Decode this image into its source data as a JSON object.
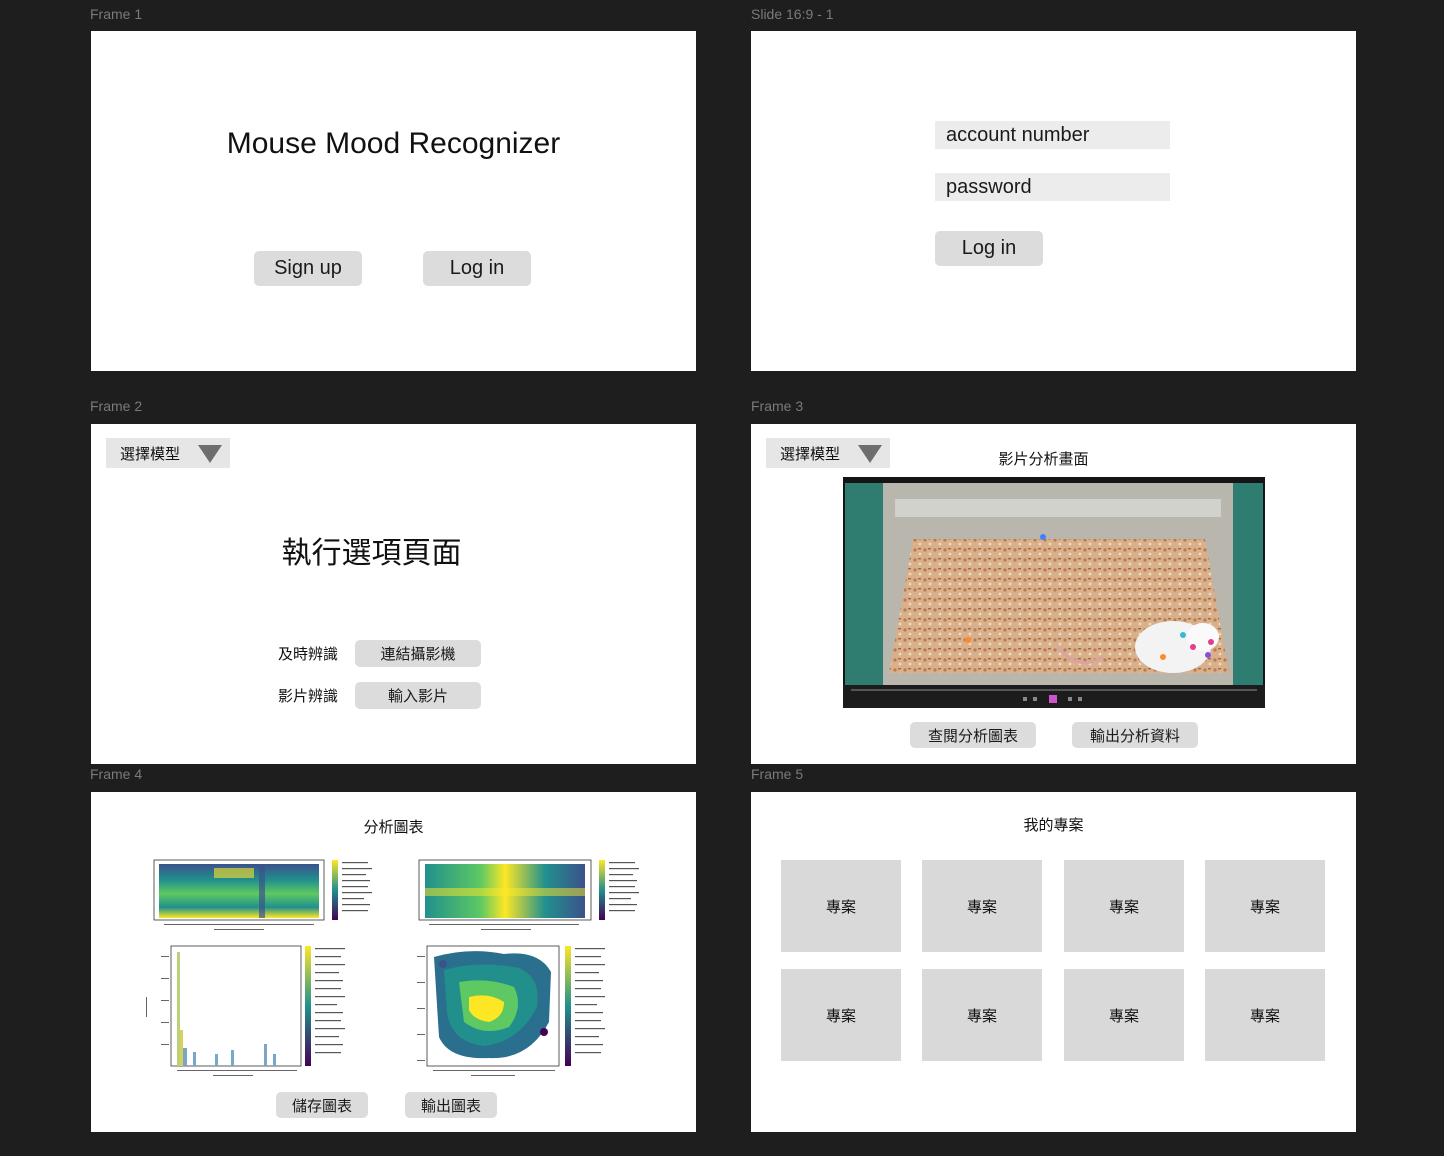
{
  "frames": {
    "frame1": {
      "label": "Frame 1",
      "title": "Mouse Mood Recognizer",
      "signup_label": "Sign up",
      "login_label": "Log in"
    },
    "slide": {
      "label": "Slide 16:9 - 1",
      "account_placeholder": "account number",
      "password_placeholder": "password",
      "login_label": "Log in"
    },
    "frame2": {
      "label": "Frame 2",
      "dropdown_label": "選擇模型",
      "title": "執行選項頁面",
      "realtime_label": "及時辨識",
      "camera_button": "連結攝影機",
      "video_label": "影片辨識",
      "import_button": "輸入影片"
    },
    "frame3": {
      "label": "Frame 3",
      "dropdown_label": "選擇模型",
      "title": "影片分析畫面",
      "view_charts_button": "查閱分析圖表",
      "export_data_button": "輸出分析資料"
    },
    "frame4": {
      "label": "Frame 4",
      "title": "分析圖表",
      "save_button": "儲存圖表",
      "export_button": "輸出圖表"
    },
    "frame5": {
      "label": "Frame 5",
      "title": "我的專案",
      "projects": [
        "專案",
        "專案",
        "專案",
        "專案",
        "專案",
        "專案",
        "專案",
        "專案"
      ]
    }
  },
  "colors": {
    "canvas": "#1e1e1e",
    "frame_bg": "#ffffff",
    "button_bg": "#dcdcdc",
    "field_bg": "#ececec",
    "card_bg": "#d9d9d9"
  }
}
